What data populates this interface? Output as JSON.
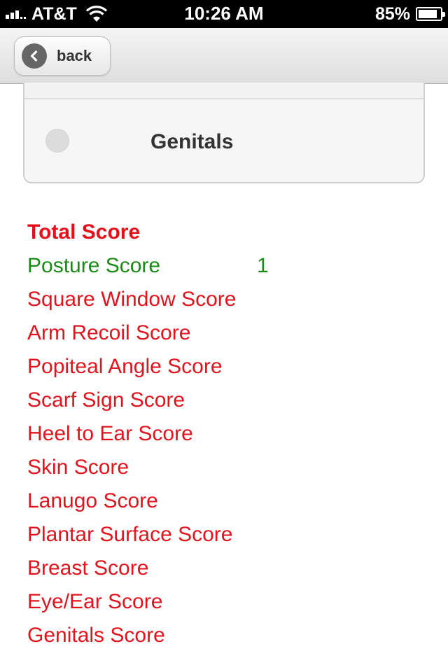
{
  "status_bar": {
    "carrier": "AT&T",
    "time": "10:26 AM",
    "battery": "85%",
    "battery_level": 0.85,
    "signal_icon": "signal-bars-icon",
    "wifi_icon": "wifi-icon",
    "battery_icon": "battery-icon"
  },
  "nav": {
    "back_label": "back",
    "back_icon": "chevron-left-icon"
  },
  "card": {
    "label": "Genitals",
    "selected": false
  },
  "scores": {
    "total": {
      "label": "Total Score",
      "value": ""
    },
    "items": [
      {
        "label": "Posture Score",
        "value": "1",
        "color": "#1c8a16"
      },
      {
        "label": "Square Window Score",
        "value": "",
        "color": "#e0141e"
      },
      {
        "label": "Arm Recoil Score",
        "value": "",
        "color": "#e0141e"
      },
      {
        "label": "Popiteal Angle Score",
        "value": "",
        "color": "#e0141e"
      },
      {
        "label": "Scarf Sign Score",
        "value": "",
        "color": "#e0141e"
      },
      {
        "label": "Heel to Ear Score",
        "value": "",
        "color": "#e0141e"
      },
      {
        "label": "Skin Score",
        "value": "",
        "color": "#e0141e"
      },
      {
        "label": "Lanugo Score",
        "value": "",
        "color": "#e0141e"
      },
      {
        "label": "Plantar Surface Score",
        "value": "",
        "color": "#e0141e"
      },
      {
        "label": "Breast Score",
        "value": "",
        "color": "#e0141e"
      },
      {
        "label": "Eye/Ear Score",
        "value": "",
        "color": "#e0141e"
      },
      {
        "label": "Genitals Score",
        "value": "",
        "color": "#e0141e"
      }
    ]
  }
}
